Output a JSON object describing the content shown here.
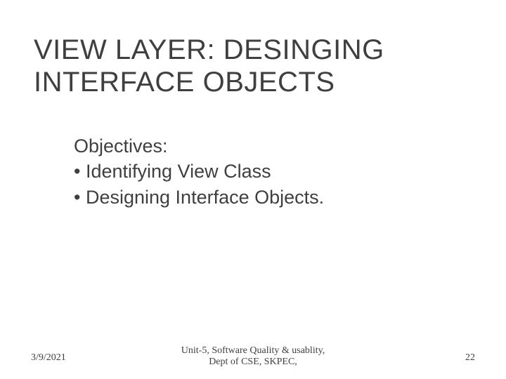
{
  "title": "VIEW LAYER: DESINGING INTERFACE OBJECTS",
  "body": {
    "heading": "Objectives:",
    "bullets": [
      "Identifying View Class",
      "Designing Interface Objects."
    ]
  },
  "footer": {
    "date": "3/9/2021",
    "center_line1": "Unit-5, Software Quality & usablity,",
    "center_line2": "Dept of CSE, SKPEC,",
    "page": "22"
  }
}
